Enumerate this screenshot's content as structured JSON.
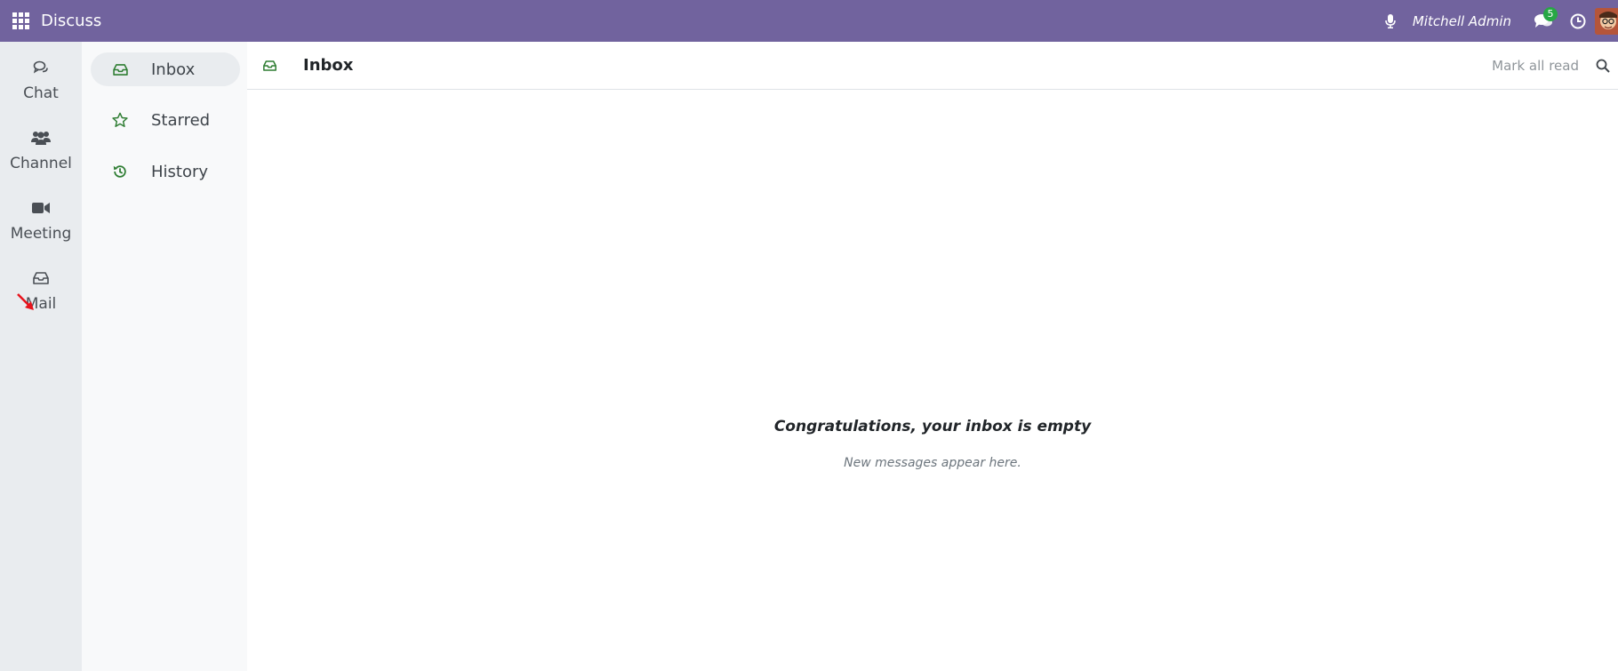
{
  "navbar": {
    "app_name": "Discuss",
    "user_name": "Mitchell Admin",
    "chat_badge": "5"
  },
  "rail": {
    "items": [
      {
        "label": "Chat",
        "icon": "chat-icon"
      },
      {
        "label": "Channel",
        "icon": "users-icon"
      },
      {
        "label": "Meeting",
        "icon": "video-icon"
      },
      {
        "label": "Mail",
        "icon": "inbox-icon"
      }
    ]
  },
  "sidebar": {
    "items": [
      {
        "label": "Inbox",
        "icon": "inbox-icon",
        "active": true
      },
      {
        "label": "Starred",
        "icon": "star-icon"
      },
      {
        "label": "History",
        "icon": "history-icon"
      }
    ]
  },
  "main": {
    "title": "Inbox",
    "mark_all_read": "Mark all read",
    "empty_title": "Congratulations, your inbox is empty",
    "empty_subtitle": "New messages appear here."
  },
  "colors": {
    "navbar": "#71639e",
    "accent_green": "#2e7d32",
    "badge": "#28a745",
    "rail_bg": "#e9ecef",
    "sidebar_bg": "#f8f9fa"
  }
}
